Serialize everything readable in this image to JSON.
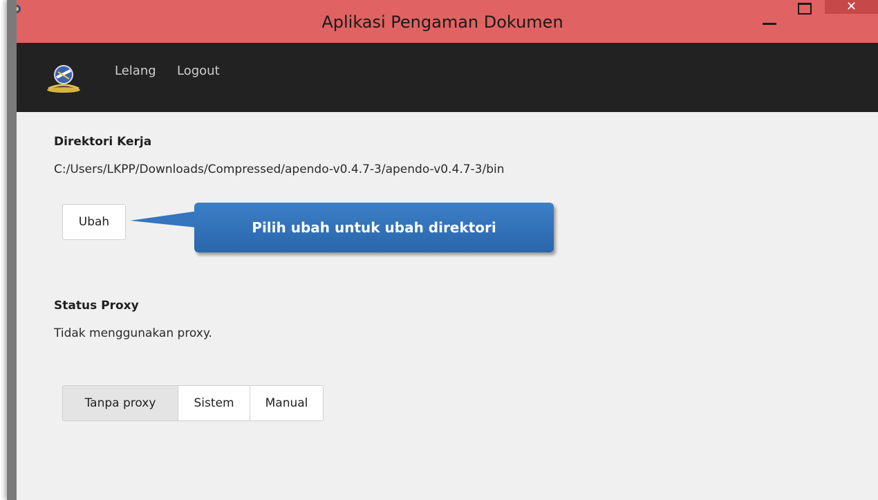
{
  "window": {
    "title": "Aplikasi Pengaman Dokumen",
    "close_glyph": "✕",
    "titlebar_color": "#e16262"
  },
  "nav": {
    "logo_icon": "lkpp-logo-icon",
    "items": [
      {
        "label": "Lelang"
      },
      {
        "label": "Logout"
      }
    ],
    "background": "#222222"
  },
  "directory": {
    "heading": "Direktori Kerja",
    "path": "C:/Users/LKPP/Downloads/Compressed/apendo-v0.4.7-3/apendo-v0.4.7-3/bin",
    "change_button": "Ubah"
  },
  "callout": {
    "text": "Pilih ubah untuk ubah direktori",
    "color": "#3576bd"
  },
  "proxy": {
    "heading": "Status Proxy",
    "status": "Tidak menggunakan proxy.",
    "options": [
      {
        "label": "Tanpa proxy",
        "selected": true
      },
      {
        "label": "Sistem",
        "selected": false
      },
      {
        "label": "Manual",
        "selected": false
      }
    ]
  }
}
